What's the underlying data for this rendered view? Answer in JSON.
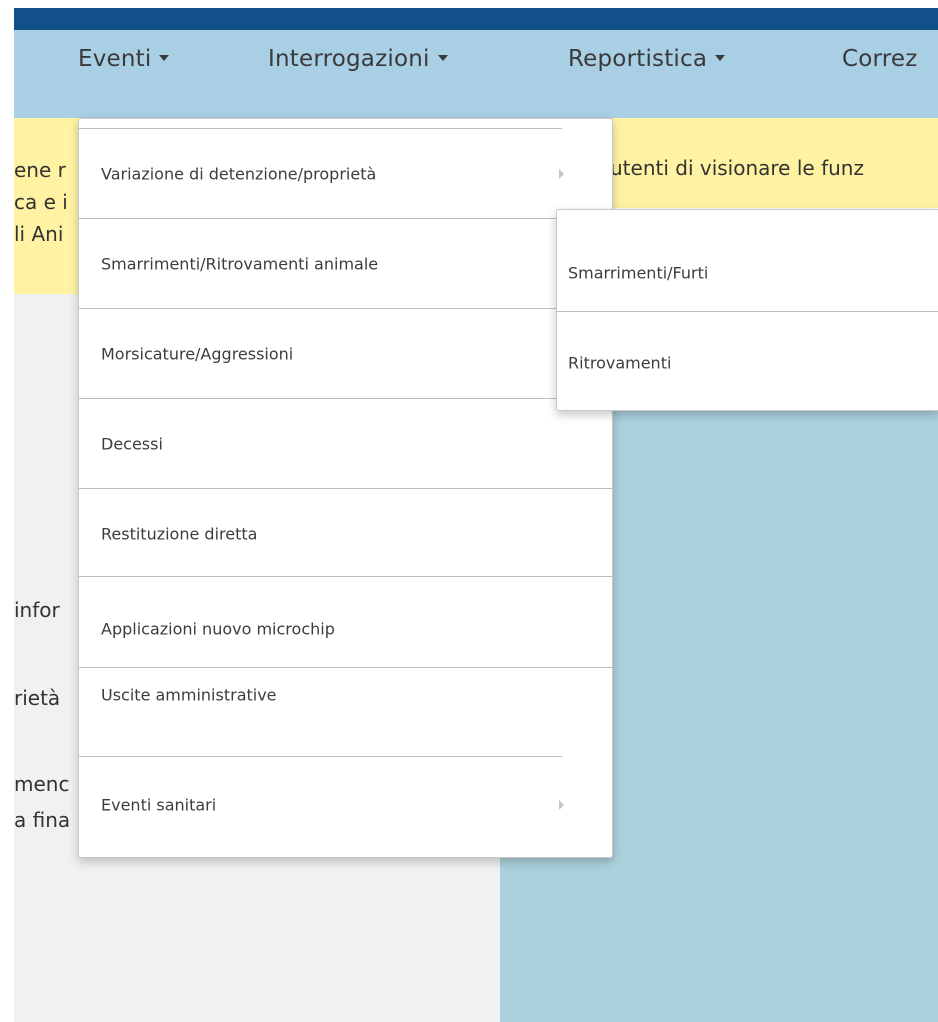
{
  "navbar": {
    "items": [
      {
        "label": "Eventi"
      },
      {
        "label": "Interrogazioni"
      },
      {
        "label": "Reportistica"
      },
      {
        "label": "Correz"
      }
    ]
  },
  "notice": {
    "left_lines": [
      "ene r",
      "ca e i",
      "li Ani"
    ],
    "right_lines": [
      "utenti di visionare le funz"
    ]
  },
  "left_content": {
    "lines": [
      "infor",
      "rietà",
      "menc",
      "a fina"
    ]
  },
  "eventi_menu": {
    "items": [
      {
        "label": "Variazione di detenzione/proprietà"
      },
      {
        "label": "Smarrimenti/Ritrovamenti animale"
      },
      {
        "label": "Morsicature/Aggressioni"
      },
      {
        "label": "Decessi"
      },
      {
        "label": "Restituzione diretta"
      },
      {
        "label": "Applicazioni nuovo microchip"
      },
      {
        "label": "Uscite amministrative"
      },
      {
        "label": "Eventi sanitari"
      }
    ]
  },
  "submenu": {
    "items": [
      {
        "label": "Smarrimenti/Furti"
      },
      {
        "label": "Ritrovamenti"
      }
    ]
  }
}
